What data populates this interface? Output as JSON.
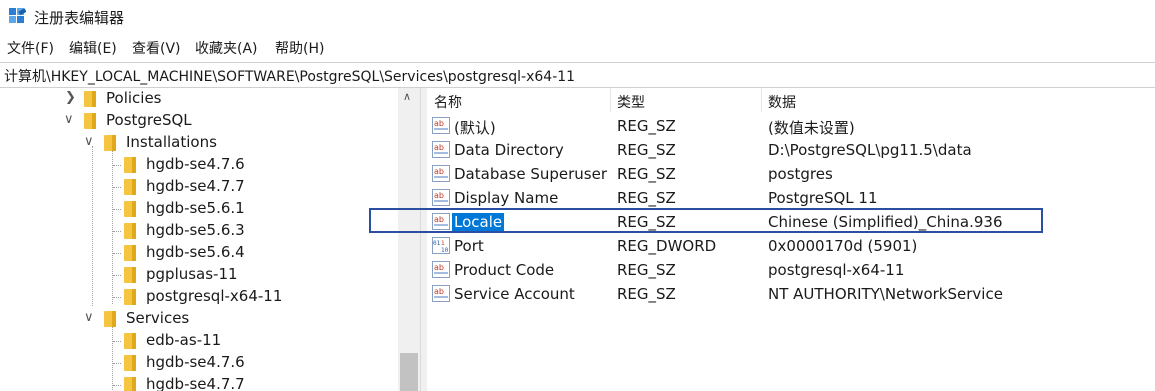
{
  "window": {
    "title": "注册表编辑器"
  },
  "menu": [
    "文件(F)",
    "编辑(E)",
    "查看(V)",
    "收藏夹(A)",
    "帮助(H)"
  ],
  "address": "计算机\\HKEY_LOCAL_MACHINE\\SOFTWARE\\PostgreSQL\\Services\\postgresql-x64-11",
  "tree": {
    "nodes": [
      {
        "label": "Policies",
        "state": "collapsed"
      },
      {
        "label": "PostgreSQL",
        "state": "expanded"
      },
      {
        "label": "Installations",
        "state": "expanded"
      },
      {
        "label": "hgdb-se4.7.6",
        "state": "leaf"
      },
      {
        "label": "hgdb-se4.7.7",
        "state": "leaf"
      },
      {
        "label": "hgdb-se5.6.1",
        "state": "leaf"
      },
      {
        "label": "hgdb-se5.6.3",
        "state": "leaf"
      },
      {
        "label": "hgdb-se5.6.4",
        "state": "leaf"
      },
      {
        "label": "pgplusas-11",
        "state": "leaf"
      },
      {
        "label": "postgresql-x64-11",
        "state": "leaf"
      },
      {
        "label": "Services",
        "state": "expanded"
      },
      {
        "label": "edb-as-11",
        "state": "leaf"
      },
      {
        "label": "hgdb-se4.7.6",
        "state": "leaf"
      },
      {
        "label": "hgdb-se4.7.7",
        "state": "leaf"
      }
    ]
  },
  "list": {
    "columns": [
      "名称",
      "类型",
      "数据"
    ],
    "rows": [
      {
        "name": "(默认)",
        "type": "REG_SZ",
        "data": "(数值未设置)",
        "icon": "string-value-icon"
      },
      {
        "name": "Data Directory",
        "type": "REG_SZ",
        "data": "D:\\PostgreSQL\\pg11.5\\data",
        "icon": "string-value-icon"
      },
      {
        "name": "Database Superuser",
        "type": "REG_SZ",
        "data": "postgres",
        "icon": "string-value-icon"
      },
      {
        "name": "Display Name",
        "type": "REG_SZ",
        "data": "PostgreSQL 11",
        "icon": "string-value-icon"
      },
      {
        "name": "Locale",
        "type": "REG_SZ",
        "data": "Chinese (Simplified)_China.936",
        "icon": "string-value-icon",
        "selected": true
      },
      {
        "name": "Port",
        "type": "REG_DWORD",
        "data": "0x0000170d (5901)",
        "icon": "binary-value-icon"
      },
      {
        "name": "Product Code",
        "type": "REG_SZ",
        "data": "postgresql-x64-11",
        "icon": "string-value-icon"
      },
      {
        "name": "Service Account",
        "type": "REG_SZ",
        "data": "NT AUTHORITY\\NetworkService",
        "icon": "string-value-icon"
      }
    ]
  },
  "colors": {
    "selection": "#0078d7",
    "highlight_box": "#2b4ea2",
    "folder": "#f5c542"
  }
}
